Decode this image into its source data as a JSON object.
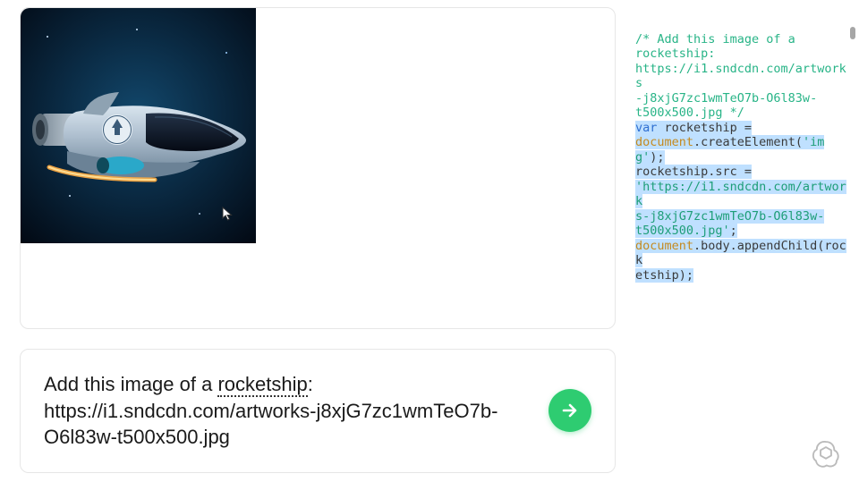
{
  "prompt": {
    "line1_prefix": "Add this image of a ",
    "line1_dotted": "rocketship",
    "line1_suffix": ":",
    "line2": "https://i1.sndcdn.com/artworks-j8xjG7zc1wmTeO7b-O6l83w-t500x500.jpg"
  },
  "code": {
    "comment_l1": "/* Add this image of a",
    "comment_l2": "rocketship:",
    "comment_l3": "https://i1.sndcdn.com/artworks",
    "comment_l4": "-j8xjG7zc1wmTeO7b-O6l83w-",
    "comment_l5": "t500x500.jpg */",
    "kw_var": "var",
    "id_rocket": " rocketship =",
    "obj_doc1": "document",
    "call_create": ".createElement(",
    "str_img": "'img'",
    "call_create_end": ");",
    "line_src_lhs": "rocketship.src =",
    "str_url_1": "'https://i1.sndcdn.com/artwork",
    "str_url_2": "s-j8xjG7zc1wmTeO7b-O6l83w-",
    "str_url_3": "t500x500.jpg'",
    "semicolon": ";",
    "obj_doc2": "document",
    "call_append_1": ".body.appendChild(rock",
    "call_append_2": "etship);"
  },
  "image": {
    "alt": "rocketship"
  }
}
